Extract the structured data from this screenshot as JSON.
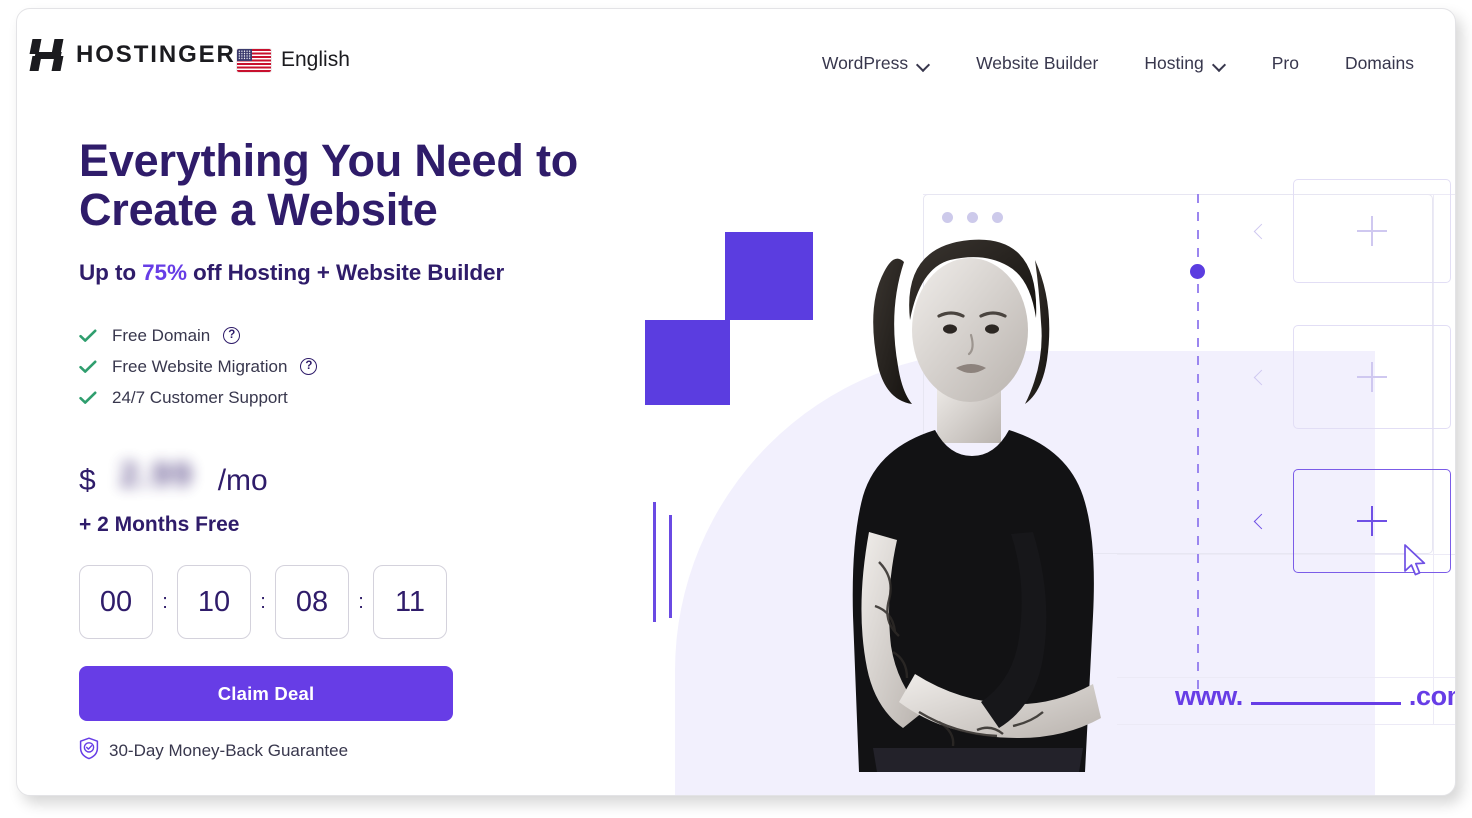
{
  "brand": {
    "logo_icon": "hostinger-h-logo-icon",
    "name": "HOSTINGER"
  },
  "language": {
    "flag_icon": "us-flag-icon",
    "label": "English"
  },
  "nav": {
    "items": [
      {
        "label": "WordPress",
        "has_dropdown": true
      },
      {
        "label": "Website Builder",
        "has_dropdown": false
      },
      {
        "label": "Hosting",
        "has_dropdown": true
      },
      {
        "label": "Pro",
        "has_dropdown": false
      },
      {
        "label": "Domains",
        "has_dropdown": false
      }
    ]
  },
  "hero": {
    "headline_line1": "Everything You Need to",
    "headline_line2": "Create a Website",
    "subhead_prefix": "Up to ",
    "subhead_percent": "75%",
    "subhead_suffix": " off Hosting + Website Builder",
    "features": [
      {
        "label": "Free Domain",
        "has_help": true
      },
      {
        "label": "Free Website Migration",
        "has_help": true
      },
      {
        "label": "24/7 Customer Support",
        "has_help": false
      }
    ],
    "help_glyph": "?",
    "price": {
      "currency": "$",
      "amount_redacted": "2.99",
      "period": "/mo"
    },
    "months_free": "+ 2 Months Free",
    "timer": {
      "separator": ":",
      "units": [
        "00",
        "10",
        "08",
        "11"
      ]
    },
    "cta_label": "Claim Deal",
    "guarantee": {
      "icon": "shield-check-icon",
      "label": "30-Day Money-Back Guarantee"
    }
  },
  "illustration": {
    "browser_dots": 3,
    "cards": [
      {
        "plus_glyph": "+",
        "active": false
      },
      {
        "plus_glyph": "+",
        "active": false
      },
      {
        "plus_glyph": "+",
        "active": true
      }
    ],
    "domain_prefix": "www.",
    "domain_suffix": ".com",
    "cursor_icon": "mouse-pointer-icon"
  },
  "colors": {
    "brand_purple": "#673de6",
    "deep_purple": "#2f1c6a",
    "accent_square": "#5b3de0",
    "blob": "#f2f0fd",
    "check_green": "#2f9e6e",
    "text_gray": "#38374d"
  }
}
